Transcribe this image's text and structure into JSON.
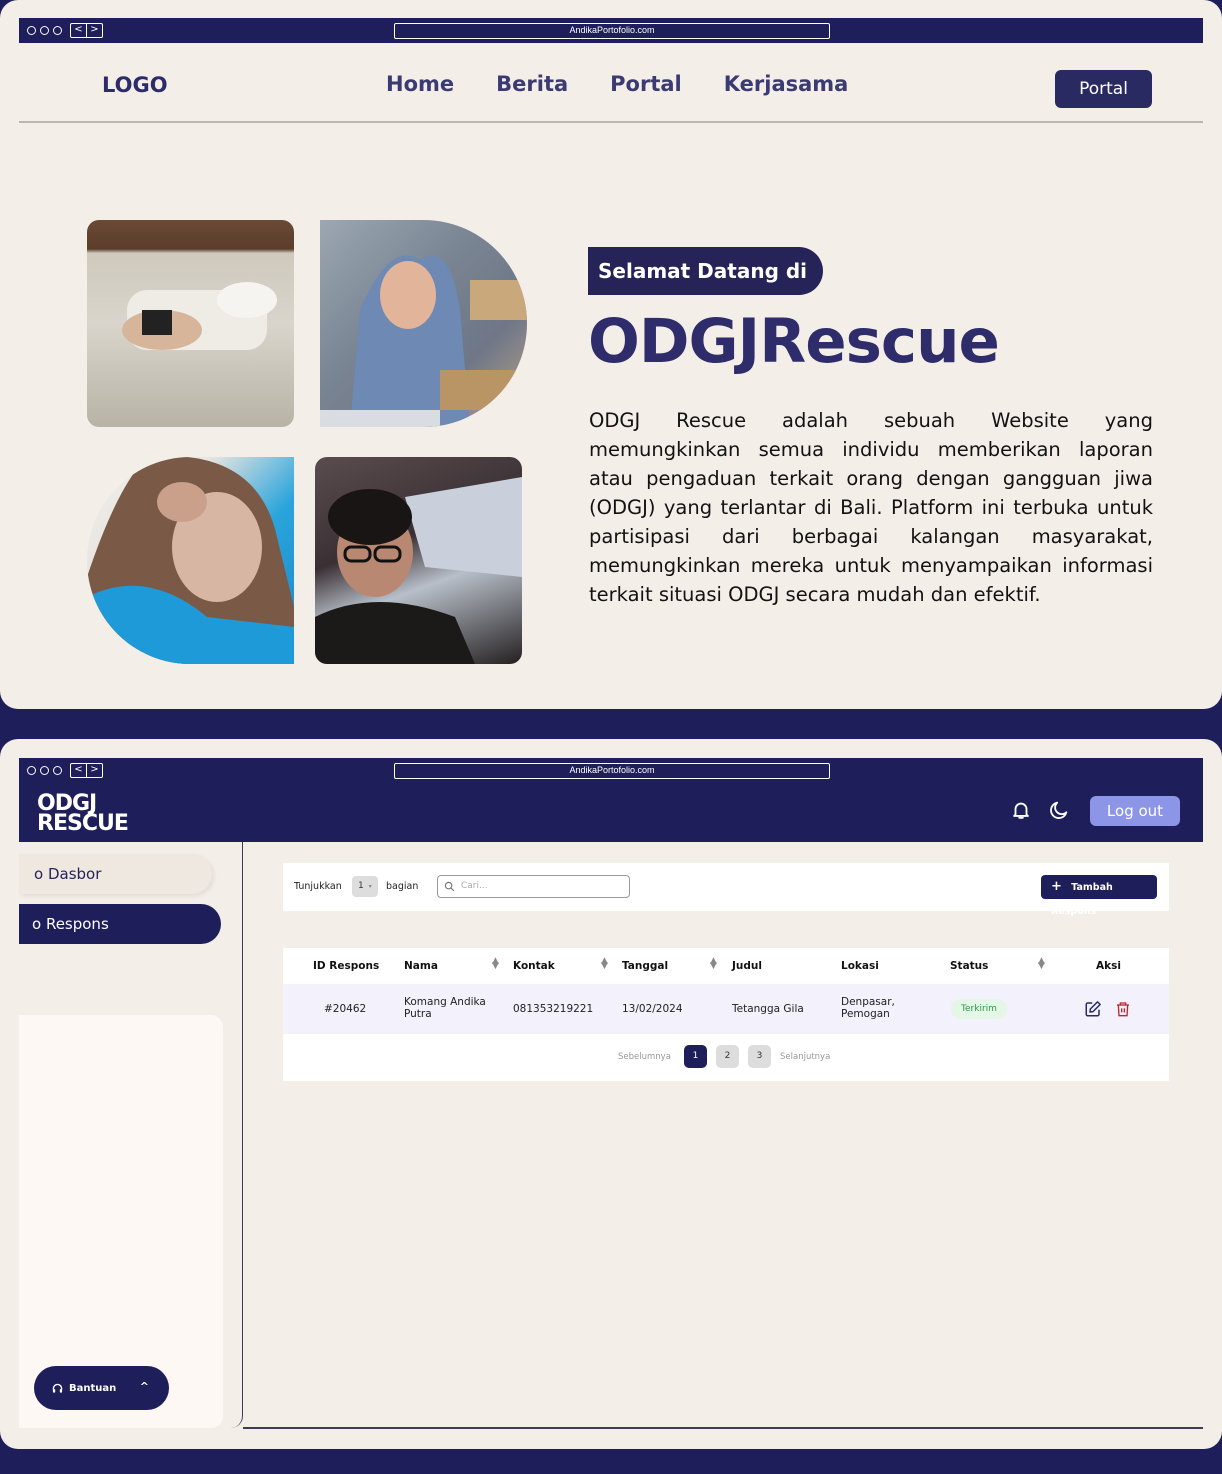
{
  "browser": {
    "url": "AndikaPortofolio.com",
    "back": "<",
    "forward": ">"
  },
  "landing": {
    "logo": "LOGO",
    "nav": [
      "Home",
      "Berita",
      "Portal",
      "Kerjasama"
    ],
    "cta": "Portal",
    "welcome": "Selamat Datang di",
    "title": "ODGJRescue",
    "description": "ODGJ Rescue adalah sebuah Website yang memungkinkan semua individu memberikan laporan atau pengaduan terkait orang dengan gangguan jiwa (ODGJ) yang terlantar di Bali. Platform ini terbuka untuk partisipasi dari berbagai kalangan masyarakat, memungkinkan mereka untuk menyampaikan informasi terkait situasi ODGJ secara mudah dan efektif."
  },
  "dashboard": {
    "logo_line1": "ODGJ",
    "logo_line2": "RESCUE",
    "logout": "Log out",
    "sidebar": {
      "items": [
        "o Dasbor",
        "o Respons"
      ],
      "help": "Bantuan",
      "help_caret": "^"
    },
    "toolbar": {
      "show_label": "Tunjukkan",
      "page_size": "1",
      "page_size_suffix": "bagian",
      "search_placeholder": "Cari...",
      "add_button": "Tambah Respons",
      "add_icon": "+"
    },
    "table": {
      "headers": [
        "ID Respons",
        "Nama",
        "Kontak",
        "Tanggal",
        "Judul",
        "Lokasi",
        "Status",
        "Aksi"
      ],
      "rows": [
        {
          "id": "#20462",
          "nama": "Komang Andika Putra",
          "kontak": "081353219221",
          "tanggal": "13/02/2024",
          "judul": "Tetangga Gila",
          "lokasi": "Denpasar, Pemogan",
          "status": "Terkirim"
        }
      ]
    },
    "pagination": {
      "prev": "Sebelumnya",
      "pages": [
        "1",
        "2",
        "3"
      ],
      "active_page": "1",
      "next": "Selanjutnya"
    }
  },
  "colors": {
    "navy": "#1e1e5a",
    "cream": "#f4eee8",
    "accent_periwinkle": "#8c95e6",
    "status_green": "#2c9a45",
    "delete_red": "#c0242c"
  }
}
